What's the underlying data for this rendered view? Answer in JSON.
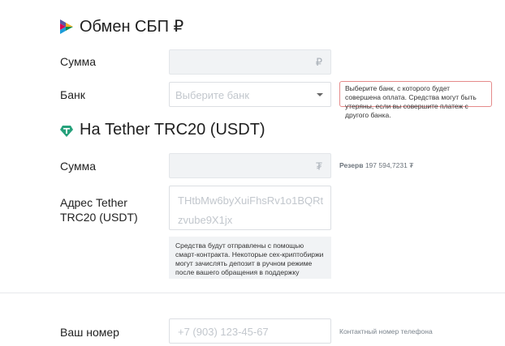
{
  "sbp_section": {
    "title": "Обмен СБП ₽",
    "amount_label": "Сумма",
    "amount_currency": "₽",
    "bank_label": "Банк",
    "bank_placeholder": "Выберите банк",
    "bank_note": "Выберите банк, с которого будет совершена оплата. Средства могут быть утеряны, если вы совершите платеж с другого банка."
  },
  "tether_section": {
    "title": "На Tether TRC20 (USDT)",
    "amount_label": "Сумма",
    "amount_currency": "₮",
    "reserve_label": "Резерв",
    "reserve_value": "197 594,7231 ₮",
    "address_label": "Адрес Tether TRC20 (USDT)",
    "address_placeholder": "THtbMw6byXuiFhsRv1o1BQRt zvube9X1jx",
    "address_note": "Средства будут отправлены с помощью смарт-контракта. Некоторые сех-криптобиржи могут зачислять депозит в ручном режиме после вашего обращения в поддержку"
  },
  "contact_section": {
    "phone_label": "Ваш номер",
    "phone_placeholder": "+7 (903) 123-45-67",
    "phone_hint": "Контактный номер телефона"
  },
  "icons": {
    "sbp": "sbp-logo-icon",
    "tether": "tether-logo-icon",
    "dropdown": "chevron-down-icon"
  },
  "colors": {
    "note_border": "#e58a8a",
    "tether_green": "#26a17b",
    "field_bg": "#f1f3f5"
  }
}
